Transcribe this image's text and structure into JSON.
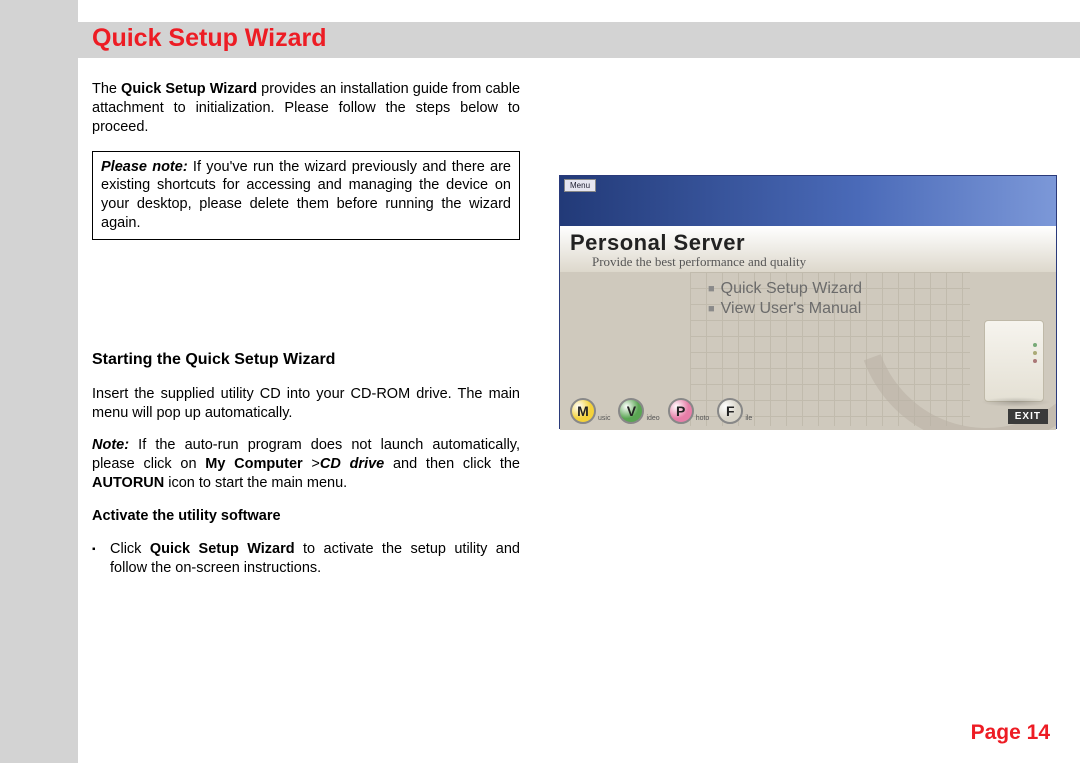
{
  "title": "Quick Setup Wizard",
  "intro": {
    "pre": "The ",
    "bold": "Quick Setup Wizard",
    "post": " provides an installation guide from cable attachment to initialization. Please follow the steps below to proceed."
  },
  "note_box": {
    "lead": "Please note:",
    "text": " If you've run the wizard previously and there are existing shortcuts for accessing and managing the device on your desktop, please delete them before running the wizard again."
  },
  "section_heading": "Starting the Quick Setup Wizard",
  "insert_para": "Insert the supplied utility CD into your CD-ROM drive. The main menu will pop up automatically.",
  "autorun": {
    "lead": "Note:",
    "t1": " If the auto-run program does not launch automatically, please click on ",
    "mycomp": "My Computer",
    "gt": " >",
    "cd": "CD drive",
    "t2": " and then click the ",
    "auto": "AUTORUN",
    "t3": " icon to start the main menu."
  },
  "sub_heading": "Activate the utility software",
  "bullet": {
    "pre": "Click ",
    "bold": "Quick Setup Wizard",
    "post": " to activate the setup utility and follow the on-screen instructions."
  },
  "page_label": "Page 14",
  "figure": {
    "menu": "Menu",
    "title": "Personal Server",
    "subtitle": "Provide the best performance and quality",
    "items": [
      "Quick Setup Wizard",
      "View User's Manual"
    ],
    "icons": [
      {
        "letter": "M",
        "label": "usic",
        "color": "#f4d23a"
      },
      {
        "letter": "V",
        "label": "ideo",
        "color": "#5aa653"
      },
      {
        "letter": "P",
        "label": "hoto",
        "color": "#e77ea8"
      },
      {
        "letter": "F",
        "label": "ile",
        "color": "#d8d4c8"
      }
    ],
    "exit": "EXIT"
  }
}
